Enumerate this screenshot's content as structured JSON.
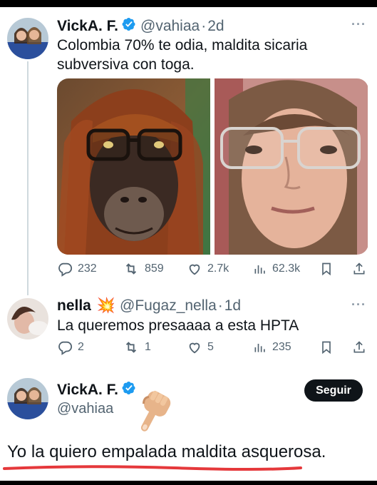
{
  "tweet1": {
    "name": "VickA. F.",
    "handle": "@vahiaa",
    "separator": "·",
    "time": "2d",
    "text": "Colombia 70% te odia, maldita sicaria subversiva con toga.",
    "stats": {
      "replies": "232",
      "retweets": "859",
      "likes": "2.7k",
      "views": "62.3k"
    }
  },
  "tweet2": {
    "name": "nella",
    "emoji": "💥",
    "handle": "@Fugaz_nella",
    "separator": "·",
    "time": "1d",
    "text": "La queremos presaaaa a esta HPTA",
    "stats": {
      "replies": "2",
      "retweets": "1",
      "likes": "5",
      "views": "235"
    }
  },
  "profile": {
    "name": "VickA. F.",
    "handle": "@vahiaa",
    "follow_label": "Seguir",
    "quote": "Yo la quiero empalada maldita asquerosa."
  },
  "colors": {
    "verified": "#1d9bf0",
    "text": "#0f1419",
    "muted": "#536471",
    "underline": "#e5383b"
  },
  "icons": [
    "verified-icon",
    "more-icon",
    "reply-icon",
    "retweet-icon",
    "like-icon",
    "views-icon",
    "bookmark-icon",
    "share-icon",
    "pointing-down-hand-icon"
  ]
}
